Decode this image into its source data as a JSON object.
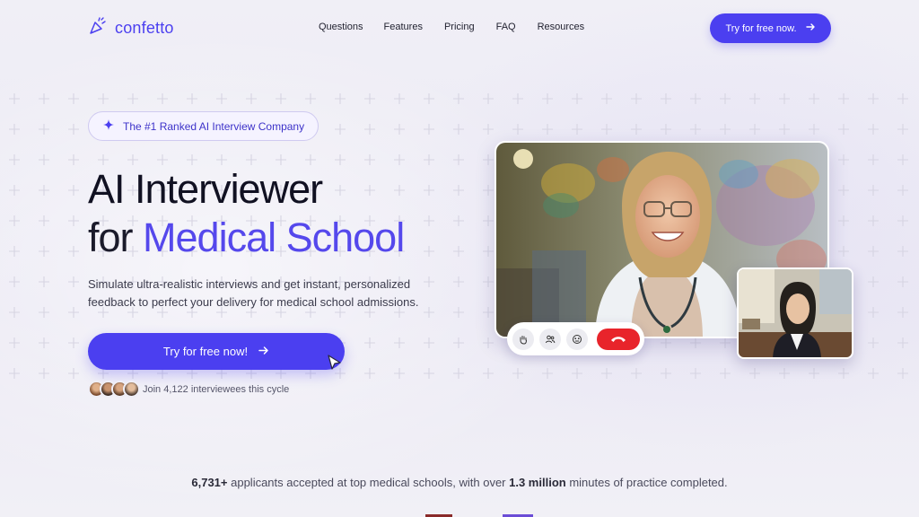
{
  "nav": {
    "logo_text": "confetto",
    "menu": [
      "Questions",
      "Features",
      "Pricing",
      "FAQ",
      "Resources"
    ],
    "cta_label": "Try for free now."
  },
  "hero": {
    "badge": "The #1 Ranked AI Interview Company",
    "title_line1": "AI Interviewer",
    "title_line2_prefix": "for ",
    "title_line2_accent": "Medical School",
    "subtitle": "Simulate ultra-realistic interviews and get instant, personalized feedback to perfect your delivery for medical school admissions.",
    "cta_label": "Try for free now!",
    "join_text": "Join 4,122 interviewees this cycle"
  },
  "stats": {
    "applicants": "6,731+",
    "text1": " applicants accepted at top medical schools, with over ",
    "minutes": "1.3 million",
    "text2": " minutes of practice completed."
  },
  "colors": {
    "brand": "#4b3ff0",
    "accent_text": "#5548ec",
    "hangup": "#e8242b"
  },
  "icons": [
    "confetti-icon",
    "arrow-right-icon",
    "sparkle-icon",
    "cursor-icon",
    "hand-icon",
    "people-icon",
    "mask-icon",
    "phone-hangup-icon"
  ]
}
